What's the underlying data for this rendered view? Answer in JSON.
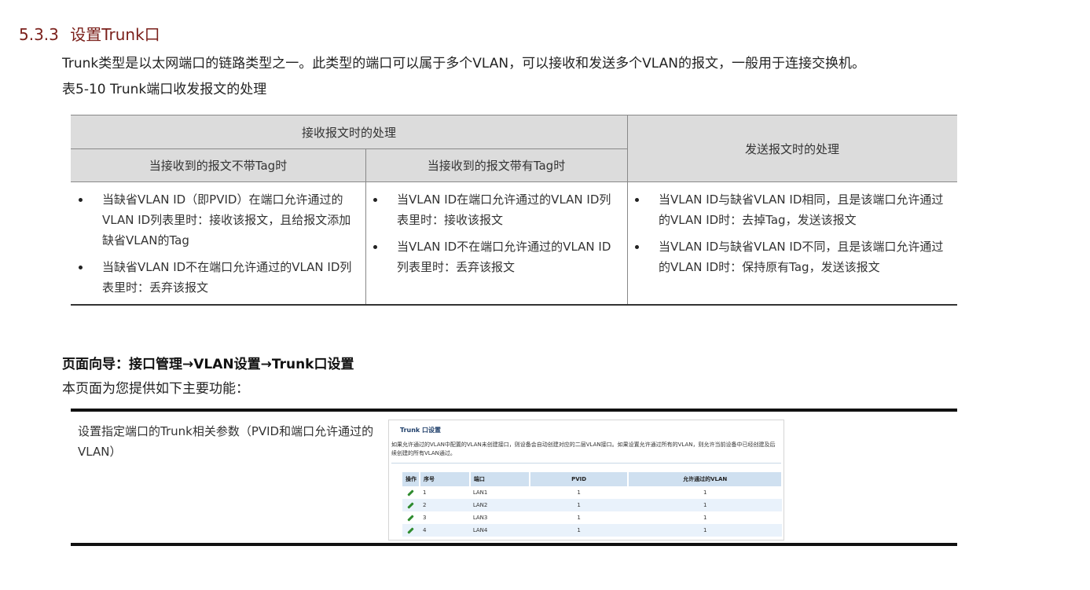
{
  "section": {
    "number": "5.3.3",
    "title": "设置Trunk口"
  },
  "intro": "Trunk类型是以太网端口的链路类型之一。此类型的端口可以属于多个VLAN，可以接收和发送多个VLAN的报文，一般用于连接交换机。",
  "table_caption": "表5-10 Trunk端口收发报文的处理",
  "table": {
    "recv_header": "接收报文时的处理",
    "send_header": "发送报文时的处理",
    "untagged_header": "当接收到的报文不带Tag时",
    "tagged_header": "当接收到的报文带有Tag时",
    "untagged_items": [
      "当缺省VLAN ID（即PVID）在端口允许通过的VLAN ID列表里时：接收该报文，且给报文添加缺省VLAN的Tag",
      "当缺省VLAN ID不在端口允许通过的VLAN ID列表里时：丢弃该报文"
    ],
    "tagged_items": [
      "当VLAN ID在端口允许通过的VLAN ID列表里时：接收该报文",
      "当VLAN ID不在端口允许通过的VLAN ID列表里时：丢弃该报文"
    ],
    "send_items": [
      "当VLAN ID与缺省VLAN ID相同，且是该端口允许通过的VLAN ID时：去掉Tag，发送该报文",
      "当VLAN ID与缺省VLAN ID不同，且是该端口允许通过的VLAN ID时：保持原有Tag，发送该报文"
    ]
  },
  "nav_heading": "页面向导：接口管理→VLAN设置→Trunk口设置",
  "nav_desc": "本页面为您提供如下主要功能：",
  "function_desc": "设置指定端口的Trunk相关参数（PVID和端口允许通过的VLAN）",
  "screenshot": {
    "title": "Trunk 口设置",
    "note": "如果允许通过的VLAN中配置的VLAN未创建接口，则设备会自动创建对应的二层VLAN接口。如果设置允许通过所有的VLAN，则允许当前设备中已经创建及后续创建的所有VLAN通过。",
    "columns": [
      "操作",
      "序号",
      "端口",
      "PVID",
      "允许通过的VLAN"
    ],
    "rows": [
      {
        "index": "1",
        "port": "LAN1",
        "pvid": "1",
        "vlan": "1"
      },
      {
        "index": "2",
        "port": "LAN2",
        "pvid": "1",
        "vlan": "1"
      },
      {
        "index": "3",
        "port": "LAN3",
        "pvid": "1",
        "vlan": "1"
      },
      {
        "index": "4",
        "port": "LAN4",
        "pvid": "1",
        "vlan": "1"
      }
    ],
    "edit_icon": "pencil-icon",
    "accent_color": "#cfe0f0"
  },
  "colors": {
    "section_title": "#7a1f1a",
    "header_bg": "#dcdcdc"
  }
}
